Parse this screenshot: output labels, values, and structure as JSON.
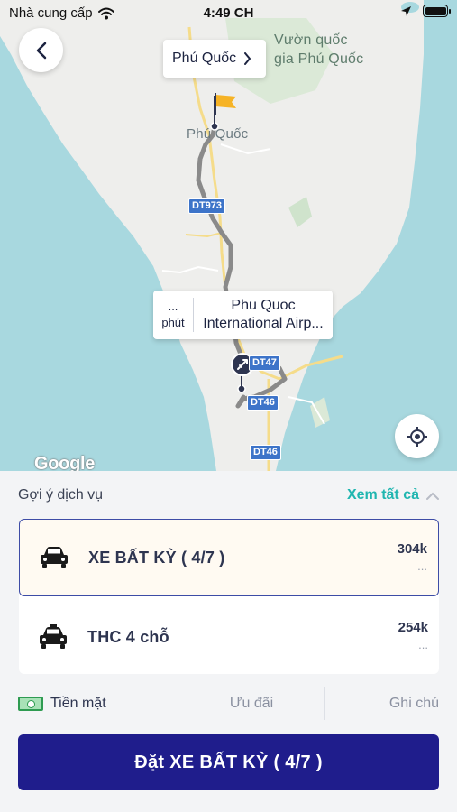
{
  "status_bar": {
    "carrier": "Nhà cung cấp",
    "time": "4:49 CH",
    "icons": [
      "wifi-icon",
      "location-arrow-icon",
      "battery-icon"
    ]
  },
  "map": {
    "labels": {
      "park": "Vườn quốc\ngia Phú Quốc",
      "town": "Phú Quốc",
      "roads": [
        "DT973",
        "DT47",
        "DT46",
        "DT46"
      ]
    },
    "attribution": "Google",
    "destination_callout": {
      "label": "Phú Quốc"
    },
    "origin_callout": {
      "eta_value": "...",
      "eta_unit": "phút",
      "place": "Phu Quoc International Airp..."
    },
    "colors": {
      "water": "#a8d8df",
      "land": "#eeeeec",
      "route": "#8a8a8a",
      "road": "#f5dc8a"
    }
  },
  "sheet": {
    "title": "Gợi ý dịch vụ",
    "see_all": "Xem tất cả",
    "services": [
      {
        "name": "XE BẤT KỲ ( 4/7 )",
        "price": "304k",
        "sub": "...",
        "selected": true,
        "icon": "car-icon"
      },
      {
        "name": "THC 4 chỗ",
        "price": "254k",
        "sub": "...",
        "selected": false,
        "icon": "taxi-icon"
      }
    ],
    "payment": "Tiền mặt",
    "promo": "Ưu đãi",
    "note": "Ghi chú",
    "book_button": "Đặt XE BẤT KỲ ( 4/7 )",
    "colors": {
      "accent": "#20b6b0",
      "primary": "#1f1d8c",
      "selected_border": "#3d4ca6"
    }
  }
}
